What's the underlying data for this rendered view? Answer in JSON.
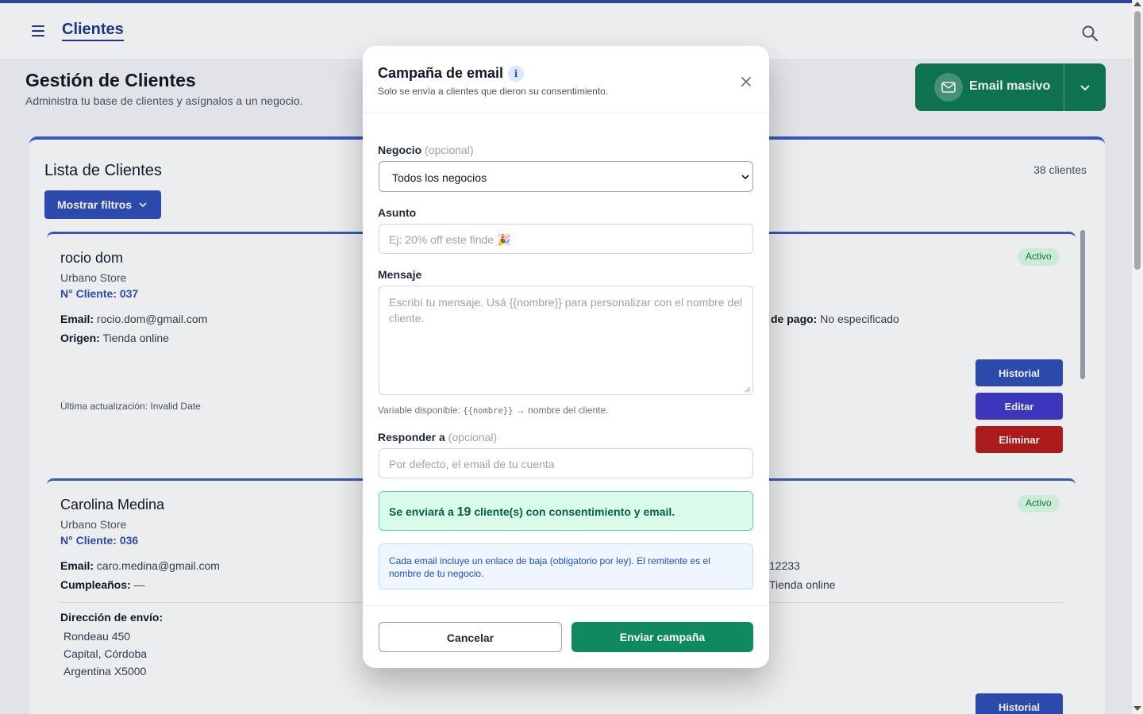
{
  "topbar": {
    "title": "Clientes",
    "menu_icon": "hamburger-icon",
    "search_icon": "search-icon"
  },
  "header": {
    "title": "Gestión de Clientes",
    "subtitle": "Administra tu base de clientes y asígnalos a un negocio.",
    "email_masivo_label": "Email masivo",
    "email_icon": "mail-icon"
  },
  "list": {
    "title": "Lista de Clientes",
    "count": "38 clientes",
    "filters_label": "Mostrar filtros"
  },
  "clients": [
    {
      "name": "rocio dom",
      "store": "Urbano Store",
      "number": "N° Cliente: 037",
      "email_label": "Email:",
      "email": "rocio.dom@gmail.com",
      "origin_label": "Origen:",
      "origin": "Tienda online",
      "payment_label": "de pago:",
      "payment": "No especificado",
      "status": "Activo",
      "updated": "Última actualización: Invalid Date",
      "actions": [
        "Historial",
        "Editar",
        "Eliminar"
      ]
    },
    {
      "name": "Carolina Medina",
      "store": "Urbano Store",
      "number": "N° Cliente: 036",
      "email_label": "Email:",
      "email": "caro.medina@gmail.com",
      "birthday_label": "Cumpleaños:",
      "birthday": "—",
      "phone_tail": "12233",
      "origin": "Tienda online",
      "status": "Activo",
      "address_label": "Dirección de envío:",
      "address": [
        "Rondeau 450",
        "Capital, Córdoba",
        "Argentina X5000"
      ],
      "actions": [
        "Historial"
      ]
    }
  ],
  "modal": {
    "title": "Campaña de email",
    "info_icon": "info-icon",
    "subtitle": "Solo se envía a clientes que dieron su consentimiento.",
    "close_icon": "close-icon",
    "negocio_label": "Negocio",
    "negocio_optional": "(opcional)",
    "negocio_value": "Todos los negocios",
    "asunto_label": "Asunto",
    "asunto_placeholder": "Ej: 20% off este finde 🎉",
    "mensaje_label": "Mensaje",
    "mensaje_placeholder": "Escribí tu mensaje. Usá {{nombre}} para personalizar con el nombre del cliente.",
    "hint_prefix": "Variable disponible:",
    "hint_code": "{{nombre}}",
    "hint_suffix": "→ nombre del cliente.",
    "responder_label": "Responder a",
    "responder_optional": "(opcional)",
    "responder_placeholder": "Por defecto, el email de tu cuenta",
    "success_prefix": "Se enviará a",
    "success_count": "19",
    "success_suffix": "cliente(s) con consentimiento y email.",
    "notice": "Cada email incluye un enlace de baja (obligatorio por ley). El remitente es el nombre de tu negocio.",
    "cancel_label": "Cancelar",
    "send_label": "Enviar campaña"
  },
  "colors": {
    "primary": "#2f4fb7",
    "success": "#0f8a5f",
    "danger": "#b91c1c",
    "edit": "#4338ca"
  }
}
